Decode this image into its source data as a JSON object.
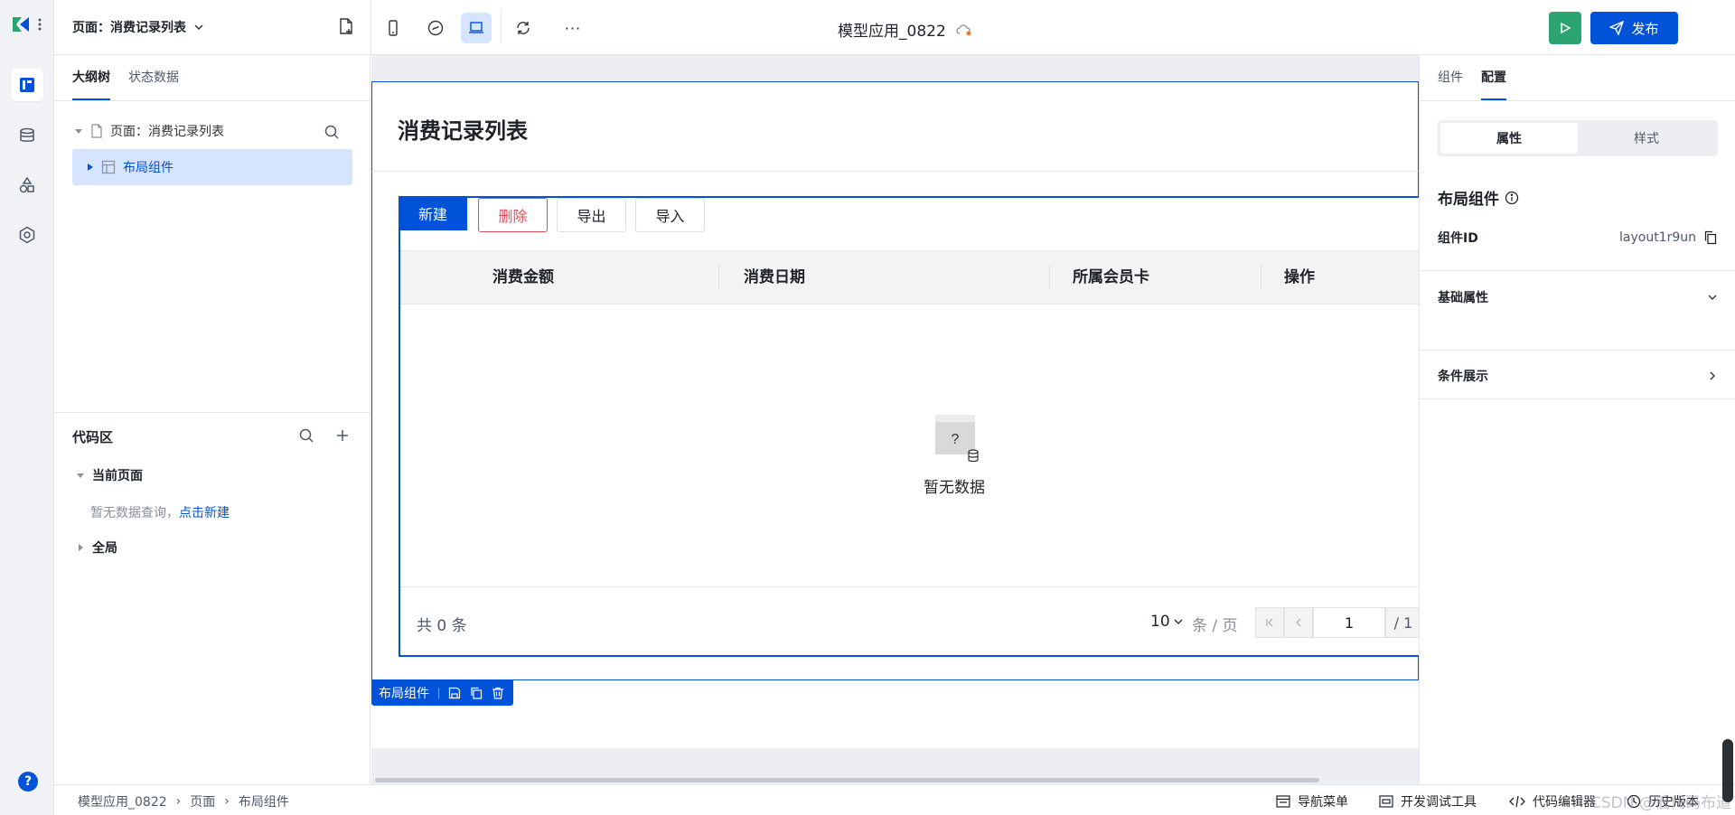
{
  "top_bar": {
    "page_selector": "页面：消费记录列表",
    "app_title": "模型应用_0822",
    "publish_label": "发布",
    "more_label": "···",
    "tools_more": "···"
  },
  "left_panel": {
    "tabs": [
      "大纲树",
      "状态数据"
    ],
    "tree_root": "页面：消费记录列表",
    "tree_child": "布局组件",
    "code_area": {
      "title": "代码区",
      "current_page": "当前页面",
      "empty_text": "暂无数据查询，",
      "create_link": "点击新建",
      "global": "全局"
    }
  },
  "canvas": {
    "page_title": "消费记录列表",
    "buttons": {
      "new": "新建",
      "delete": "删除",
      "export": "导出",
      "import": "导入"
    },
    "columns": [
      "消费金额",
      "消费日期",
      "所属会员卡",
      "操作"
    ],
    "empty_text": "暂无数据",
    "footer": {
      "total": "共  0  条",
      "page_size": "10",
      "per_page": "条 / 页",
      "current_page": "1",
      "total_pages": "/ 1"
    },
    "selection_tag": "布局组件"
  },
  "right_panel": {
    "tabs": [
      "组件",
      "配置"
    ],
    "segments": [
      "属性",
      "样式"
    ],
    "component_title": "布局组件",
    "id_label": "组件ID",
    "id_value": "layout1r9un",
    "sections": [
      "基础属性",
      "条件展示"
    ]
  },
  "status_bar": {
    "breadcrumb": [
      "模型应用_0822",
      "页面",
      "布局组件"
    ],
    "items": [
      "导航菜单",
      "开发调试工具",
      "代码编辑器",
      "历史版本"
    ],
    "watermark": "CSDN @低代码布道师"
  },
  "colors": {
    "accent": "#0052d9",
    "run": "#2ba471",
    "danger": "#e34d59"
  }
}
